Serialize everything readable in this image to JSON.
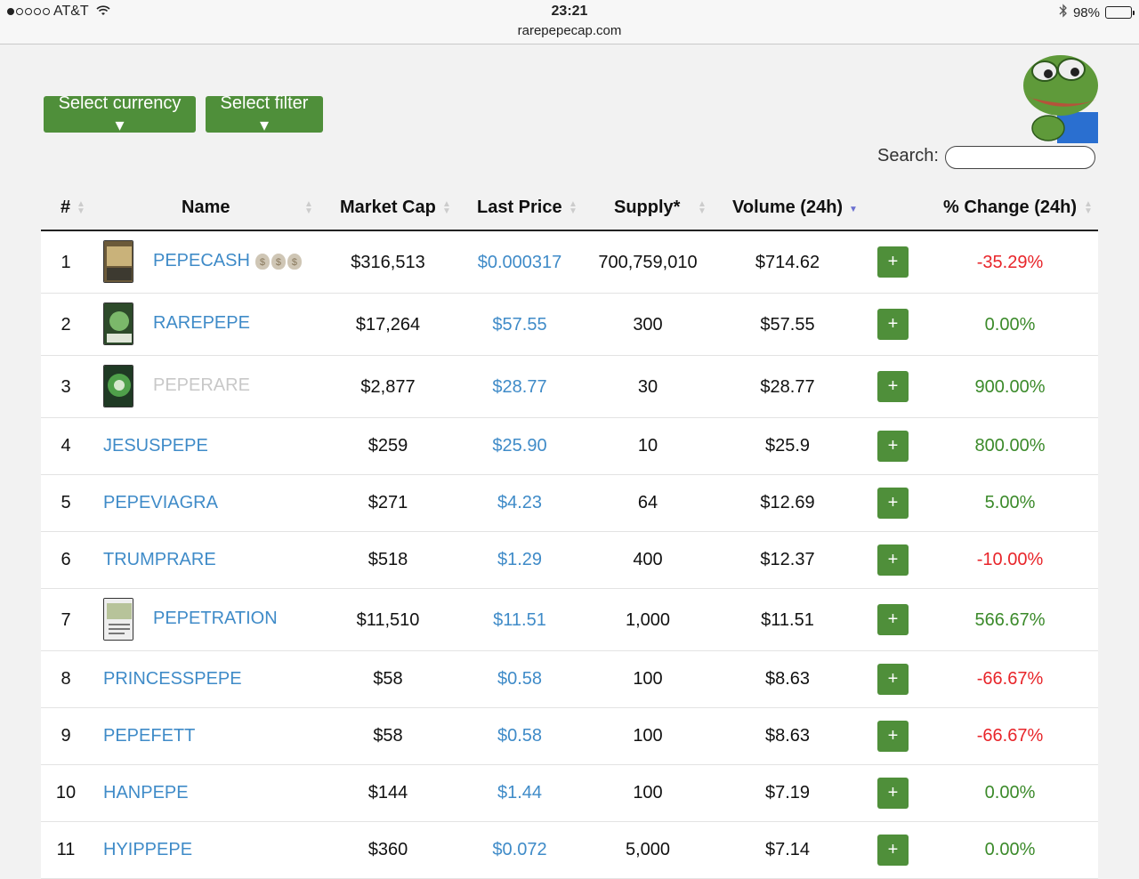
{
  "status_bar": {
    "carrier": "AT&T",
    "time": "23:21",
    "url": "rarepepecap.com",
    "battery": "98%",
    "battery_level": 0.98
  },
  "controls": {
    "currency_label": "Select currency ▾",
    "filter_label": "Select filter ▾",
    "search_label": "Search:",
    "search_value": ""
  },
  "table": {
    "headers": {
      "num": "#",
      "name": "Name",
      "market_cap": "Market Cap",
      "last_price": "Last Price",
      "supply": "Supply*",
      "volume": "Volume (24h)",
      "change": "% Change (24h)"
    },
    "rows": [
      {
        "num": "1",
        "name": "PEPECASH",
        "market_cap": "$316,513",
        "last_price": "$0.000317",
        "supply": "700,759,010",
        "volume": "$714.62",
        "change": "-35.29%",
        "plus": "+"
      },
      {
        "num": "2",
        "name": "RAREPEPE",
        "market_cap": "$17,264",
        "last_price": "$57.55",
        "supply": "300",
        "volume": "$57.55",
        "change": "0.00%",
        "plus": "+"
      },
      {
        "num": "3",
        "name": "PEPERARE",
        "market_cap": "$2,877",
        "last_price": "$28.77",
        "supply": "30",
        "volume": "$28.77",
        "change": "900.00%",
        "plus": "+"
      },
      {
        "num": "4",
        "name": "JESUSPEPE",
        "market_cap": "$259",
        "last_price": "$25.90",
        "supply": "10",
        "volume": "$25.9",
        "change": "800.00%",
        "plus": "+"
      },
      {
        "num": "5",
        "name": "PEPEVIAGRA",
        "market_cap": "$271",
        "last_price": "$4.23",
        "supply": "64",
        "volume": "$12.69",
        "change": "5.00%",
        "plus": "+"
      },
      {
        "num": "6",
        "name": "TRUMPRARE",
        "market_cap": "$518",
        "last_price": "$1.29",
        "supply": "400",
        "volume": "$12.37",
        "change": "-10.00%",
        "plus": "+"
      },
      {
        "num": "7",
        "name": "PEPETRATION",
        "market_cap": "$11,510",
        "last_price": "$11.51",
        "supply": "1,000",
        "volume": "$11.51",
        "change": "566.67%",
        "plus": "+"
      },
      {
        "num": "8",
        "name": "PRINCESSPEPE",
        "market_cap": "$58",
        "last_price": "$0.58",
        "supply": "100",
        "volume": "$8.63",
        "change": "-66.67%",
        "plus": "+"
      },
      {
        "num": "9",
        "name": "PEPEFETT",
        "market_cap": "$58",
        "last_price": "$0.58",
        "supply": "100",
        "volume": "$8.63",
        "change": "-66.67%",
        "plus": "+"
      },
      {
        "num": "10",
        "name": "HANPEPE",
        "market_cap": "$144",
        "last_price": "$1.44",
        "supply": "100",
        "volume": "$7.19",
        "change": "0.00%",
        "plus": "+"
      },
      {
        "num": "11",
        "name": "HYIPPEPE",
        "market_cap": "$360",
        "last_price": "$0.072",
        "supply": "5,000",
        "volume": "$7.14",
        "change": "0.00%",
        "plus": "+"
      }
    ]
  },
  "colors": {
    "button_green": "#4f8f3a",
    "link_blue": "#3f8bc8",
    "negative": "#e8252a",
    "positive": "#3b8a2a"
  }
}
